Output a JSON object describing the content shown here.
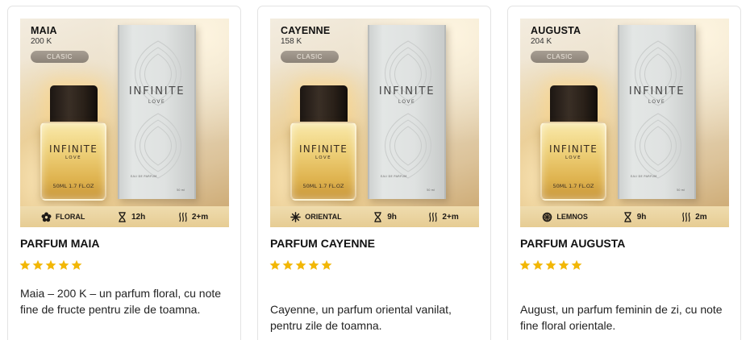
{
  "products": [
    {
      "name_label": "MAIA",
      "price_label": "200 K",
      "pill_label": "CLASIC",
      "brand": "INFINITE",
      "brand_sub": "LOVE",
      "bottle_volume": "50ML 1.7 FL.OZ",
      "box_edp": "EAU DE PARFUM",
      "box_ml": "50 ml",
      "family_icon": "flower-icon",
      "family_label": "FLORAL",
      "duration_label": "12h",
      "trail_label": "2+m",
      "title": "PARFUM MAIA",
      "rating": 5,
      "description": "Maia – 200 K – un parfum floral, cu note fine de fructe pentru zile de toamna."
    },
    {
      "name_label": "CAYENNE",
      "price_label": "158 K",
      "pill_label": "CLASIC",
      "brand": "INFINITE",
      "brand_sub": "LOVE",
      "bottle_volume": "50ML 1.7 FL.OZ",
      "box_edp": "EAU DE PARFUM",
      "box_ml": "50 ml",
      "family_icon": "sparkle-icon",
      "family_label": "ORIENTAL",
      "duration_label": "9h",
      "trail_label": "2+m",
      "title": "PARFUM CAYENNE",
      "rating": 5,
      "description": "Cayenne, un parfum oriental vanilat, pentru zile de toamna."
    },
    {
      "name_label": "AUGUSTA",
      "price_label": "204 K",
      "pill_label": "CLASIC",
      "brand": "INFINITE",
      "brand_sub": "LOVE",
      "bottle_volume": "50ML 1.7 FL.OZ",
      "box_edp": "EAU DE PARFUM",
      "box_ml": "50 ml",
      "family_icon": "lemon-slice-icon",
      "family_label": "LEMNOS",
      "duration_label": "9h",
      "trail_label": "2m",
      "title": "PARFUM AUGUSTA",
      "rating": 5,
      "description": "August, un parfum feminin de zi, cu note fine floral orientale."
    }
  ],
  "colors": {
    "star": "#f2b705",
    "attribute_bar": "#e9d29c",
    "text": "#222222"
  }
}
